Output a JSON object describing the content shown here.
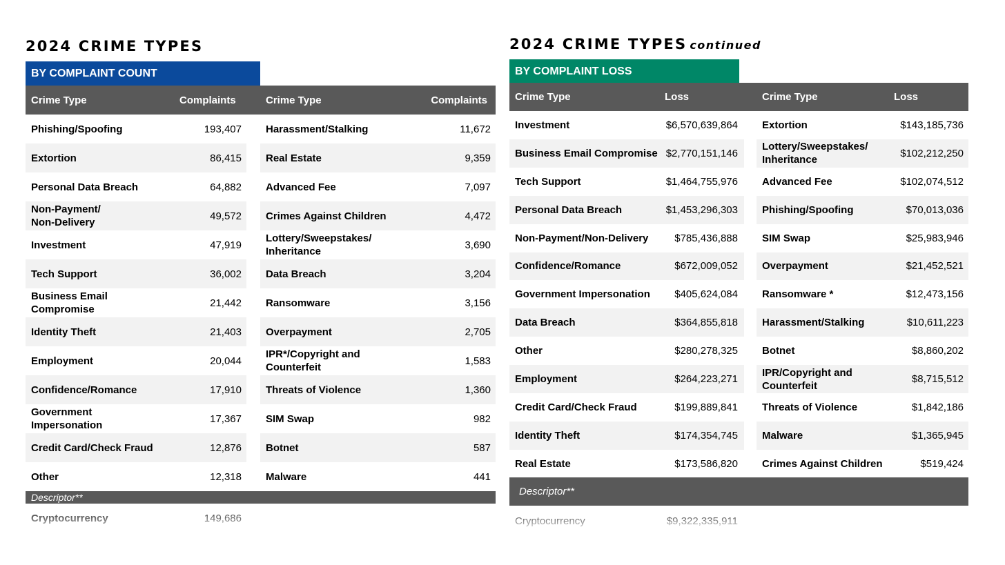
{
  "left": {
    "title": "2024 CRIME TYPES",
    "tab": "BY COMPLAINT COUNT",
    "tab_color": "#0b4a9c",
    "col1_name_header": "Crime Type",
    "col1_value_header": "Complaints",
    "col2_name_header": "Crime Type",
    "col2_value_header": "Complaints",
    "col1": [
      {
        "name": "Phishing/Spoofing",
        "value": "193,407"
      },
      {
        "name": "Extortion",
        "value": "86,415"
      },
      {
        "name": "Personal Data Breach",
        "value": "64,882"
      },
      {
        "name": "Non-Payment/\nNon-Delivery",
        "value": "49,572"
      },
      {
        "name": "Investment",
        "value": "47,919"
      },
      {
        "name": "Tech Support",
        "value": "36,002"
      },
      {
        "name": "Business Email\nCompromise",
        "value": "21,442"
      },
      {
        "name": "Identity Theft",
        "value": "21,403"
      },
      {
        "name": "Employment",
        "value": "20,044"
      },
      {
        "name": "Confidence/Romance",
        "value": "17,910"
      },
      {
        "name": "Government\nImpersonation",
        "value": "17,367"
      },
      {
        "name": "Credit Card/Check Fraud",
        "value": "12,876"
      },
      {
        "name": "Other",
        "value": "12,318"
      }
    ],
    "col2": [
      {
        "name": "Harassment/Stalking",
        "value": "11,672"
      },
      {
        "name": "Real Estate",
        "value": "9,359"
      },
      {
        "name": "Advanced Fee",
        "value": "7,097"
      },
      {
        "name": "Crimes Against Children",
        "value": "4,472"
      },
      {
        "name": "Lottery/Sweepstakes/\nInheritance",
        "value": "3,690"
      },
      {
        "name": "Data Breach",
        "value": "3,204"
      },
      {
        "name": "Ransomware",
        "value": "3,156"
      },
      {
        "name": "Overpayment",
        "value": "2,705"
      },
      {
        "name": "IPR*/Copyright and\nCounterfeit",
        "value": "1,583"
      },
      {
        "name": "Threats of Violence",
        "value": "1,360"
      },
      {
        "name": "SIM Swap",
        "value": "982"
      },
      {
        "name": "Botnet",
        "value": "587"
      },
      {
        "name": "Malware",
        "value": "441"
      }
    ],
    "descriptor_label": "Descriptor**",
    "descriptor_row": {
      "name": "Cryptocurrency",
      "value": "149,686"
    }
  },
  "right": {
    "title": "2024 CRIME TYPES",
    "title_suffix": "continued",
    "tab": "BY COMPLAINT LOSS",
    "tab_color": "#008767",
    "col1_name_header": "Crime Type",
    "col1_value_header": "Loss",
    "col2_name_header": "Crime Type",
    "col2_value_header": "Loss",
    "col1": [
      {
        "name": "Investment",
        "value": "$6,570,639,864"
      },
      {
        "name": "Business Email Compromise",
        "value": "$2,770,151,146"
      },
      {
        "name": "Tech Support",
        "value": "$1,464,755,976"
      },
      {
        "name": "Personal Data Breach",
        "value": "$1,453,296,303"
      },
      {
        "name": "Non-Payment/Non-Delivery",
        "value": "$785,436,888"
      },
      {
        "name": "Confidence/Romance",
        "value": "$672,009,052"
      },
      {
        "name": "Government Impersonation",
        "value": "$405,624,084"
      },
      {
        "name": "Data Breach",
        "value": "$364,855,818"
      },
      {
        "name": "Other",
        "value": "$280,278,325"
      },
      {
        "name": "Employment",
        "value": "$264,223,271"
      },
      {
        "name": "Credit Card/Check Fraud",
        "value": "$199,889,841"
      },
      {
        "name": "Identity Theft",
        "value": "$174,354,745"
      },
      {
        "name": "Real Estate",
        "value": "$173,586,820"
      }
    ],
    "col2": [
      {
        "name": "Extortion",
        "value": "$143,185,736"
      },
      {
        "name": "Lottery/Sweepstakes/\nInheritance",
        "value": "$102,212,250"
      },
      {
        "name": "Advanced Fee",
        "value": "$102,074,512"
      },
      {
        "name": "Phishing/Spoofing",
        "value": "$70,013,036"
      },
      {
        "name": "SIM Swap",
        "value": "$25,983,946"
      },
      {
        "name": "Overpayment",
        "value": "$21,452,521"
      },
      {
        "name": "Ransomware *",
        "value": "$12,473,156"
      },
      {
        "name": "Harassment/Stalking",
        "value": "$10,611,223"
      },
      {
        "name": "Botnet",
        "value": "$8,860,202"
      },
      {
        "name": "IPR/Copyright and\nCounterfeit",
        "value": "$8,715,512"
      },
      {
        "name": "Threats of Violence",
        "value": "$1,842,186"
      },
      {
        "name": "Malware",
        "value": "$1,365,945"
      },
      {
        "name": "Crimes Against Children",
        "value": "$519,424"
      }
    ],
    "descriptor_label": "Descriptor**",
    "descriptor_row": {
      "name": "Cryptocurrency",
      "value": "$9,322,335,911"
    }
  }
}
